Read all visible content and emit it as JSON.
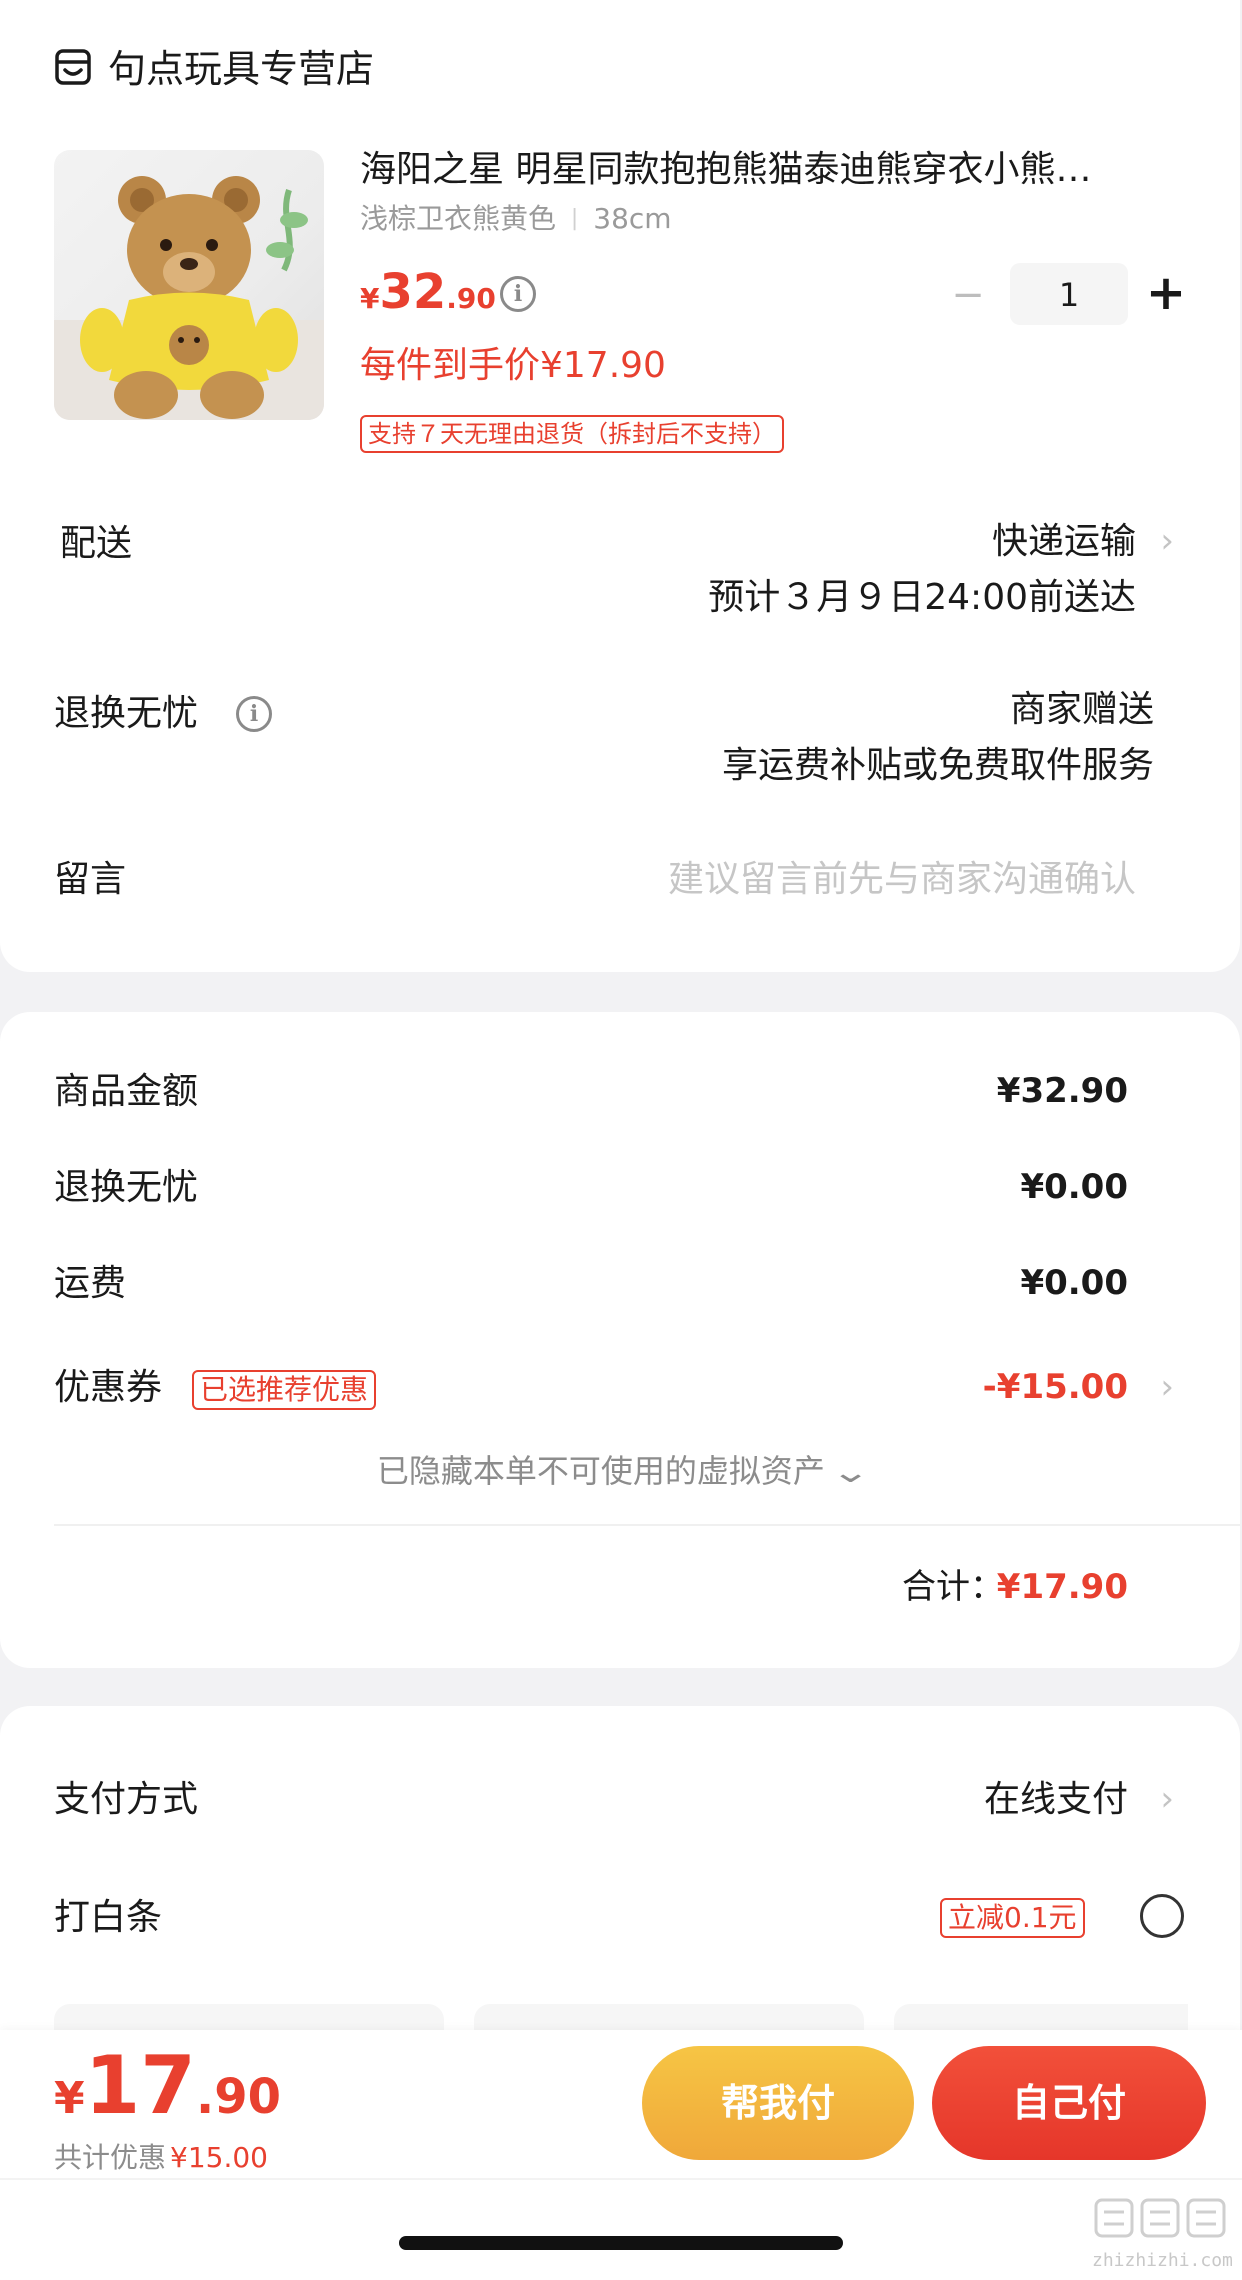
{
  "store": {
    "name": "句点玩具专营店"
  },
  "product": {
    "title": "海阳之星 明星同款抱抱熊猫泰迪熊穿衣小熊…",
    "spec_color": "浅棕卫衣熊黄色",
    "spec_size": "38cm",
    "price_symbol": "¥",
    "price_int": "32",
    "price_dec": ".90",
    "unit_price": "每件到手价¥17.90",
    "quantity": "1",
    "qty_minus": "−",
    "qty_plus": "+",
    "return_badge": "支持７天无理由退货（拆封后不支持）"
  },
  "delivery": {
    "label": "配送",
    "method": "快递运输",
    "eta": "预计３月９日24:00前送达"
  },
  "worry_free": {
    "label": "退换无忧",
    "line1": "商家赠送",
    "line2": "享运费补贴或免费取件服务"
  },
  "message": {
    "label": "留言",
    "placeholder": "建议留言前先与商家沟通确认"
  },
  "summary": {
    "goods_label": "商品金额",
    "goods_value": "¥32.90",
    "worry_label": "退换无忧",
    "worry_value": "¥0.00",
    "shipping_label": "运费",
    "shipping_value": "¥0.00",
    "coupon_label": "优惠券",
    "coupon_tag": "已选推荐优惠",
    "coupon_value": "-¥15.00",
    "hidden_assets": "已隐藏本单不可使用的虚拟资产",
    "total_label": "合计：",
    "total_value": "¥17.90"
  },
  "payment": {
    "method_label": "支付方式",
    "method_value": "在线支付",
    "baitiao_label": "打白条",
    "baitiao_tag": "立减0.1元"
  },
  "bottom_bar": {
    "price_symbol": "¥",
    "price_int": "17",
    "price_dec": ".90",
    "discount_label": "共计优惠",
    "discount_value": "¥15.00",
    "help_pay": "帮我付",
    "self_pay": "自己付"
  },
  "watermark": {
    "text": "zhizhizhi.com"
  },
  "colors": {
    "accent_red": "#e8402f",
    "help_pay_gradient": [
      "#f6c544",
      "#f0a83a"
    ],
    "self_pay_gradient": [
      "#f2503a",
      "#e5362a"
    ]
  }
}
